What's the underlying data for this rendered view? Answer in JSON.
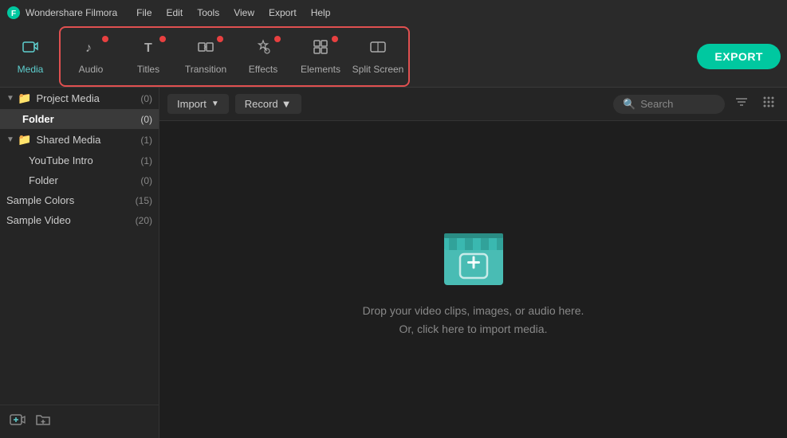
{
  "app": {
    "name": "Wondershare Filmora",
    "logo_symbol": "🎬"
  },
  "menu": {
    "items": [
      "File",
      "Edit",
      "Tools",
      "View",
      "Export",
      "Help"
    ]
  },
  "toolbar": {
    "export_label": "EXPORT",
    "media_label": "Media",
    "buttons": [
      {
        "id": "audio",
        "label": "Audio",
        "icon": "♪",
        "has_dot": true
      },
      {
        "id": "titles",
        "label": "Titles",
        "icon": "T",
        "has_dot": true
      },
      {
        "id": "transition",
        "label": "Transition",
        "icon": "⇄",
        "has_dot": true
      },
      {
        "id": "effects",
        "label": "Effects",
        "icon": "✦",
        "has_dot": true
      },
      {
        "id": "elements",
        "label": "Elements",
        "icon": "⊞",
        "has_dot": true
      },
      {
        "id": "split_screen",
        "label": "Split Screen",
        "icon": "▦",
        "has_dot": false
      }
    ]
  },
  "sidebar": {
    "project_media": {
      "label": "Project Media",
      "count": "(0)"
    },
    "folder_selected": {
      "label": "Folder",
      "count": "(0)"
    },
    "shared_media": {
      "label": "Shared Media",
      "count": "(1)"
    },
    "youtube_intro": {
      "label": "YouTube Intro",
      "count": "(1)"
    },
    "shared_folder": {
      "label": "Folder",
      "count": "(0)"
    },
    "sample_colors": {
      "label": "Sample Colors",
      "count": "(15)"
    },
    "sample_video": {
      "label": "Sample Video",
      "count": "(20)"
    },
    "bottom_icons": [
      "➕",
      "📁"
    ]
  },
  "content_toolbar": {
    "import_label": "Import",
    "record_label": "Record",
    "search_placeholder": "Search"
  },
  "drop_zone": {
    "line1": "Drop your video clips, images, or audio here.",
    "line2": "Or, click here to import media."
  }
}
